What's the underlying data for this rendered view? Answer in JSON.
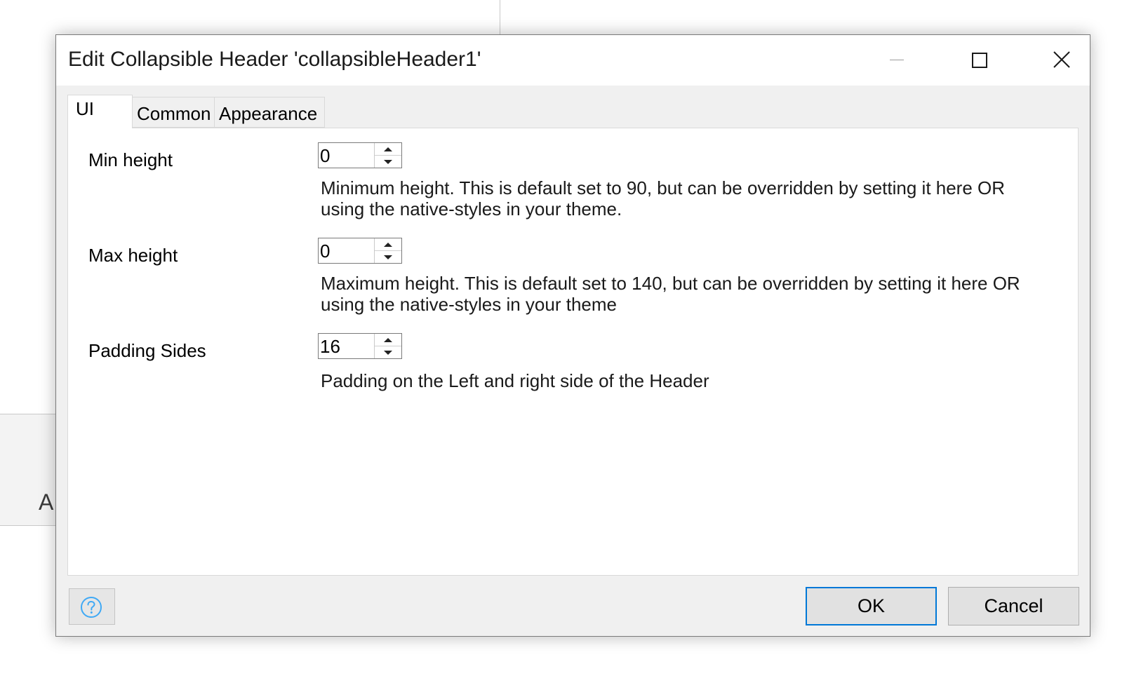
{
  "background": {
    "partial_letter": "A"
  },
  "dialog": {
    "title": "Edit Collapsible Header 'collapsibleHeader1'",
    "tabs": [
      {
        "label": "UI",
        "active": true
      },
      {
        "label": "Common",
        "active": false
      },
      {
        "label": "Appearance",
        "active": false
      }
    ],
    "fields": [
      {
        "label": "Min height",
        "value": "0",
        "description": "Minimum height. This is default set to 90, but can be overridden by setting it here OR using the native-styles in your theme."
      },
      {
        "label": "Max height",
        "value": "0",
        "description": "Maximum height. This is default set to 140, but can be overridden by setting it here OR using the native-styles in your theme"
      },
      {
        "label": "Padding Sides",
        "value": "16",
        "description": "Padding on the Left and right side of the Header"
      }
    ],
    "buttons": {
      "ok": "OK",
      "cancel": "Cancel"
    },
    "icons": {
      "minimize": "minimize-icon",
      "maximize": "maximize-icon",
      "close": "close-icon",
      "help": "help-question-icon"
    },
    "colors": {
      "accent": "#0078d7",
      "help_icon": "#3fa9f5"
    }
  }
}
